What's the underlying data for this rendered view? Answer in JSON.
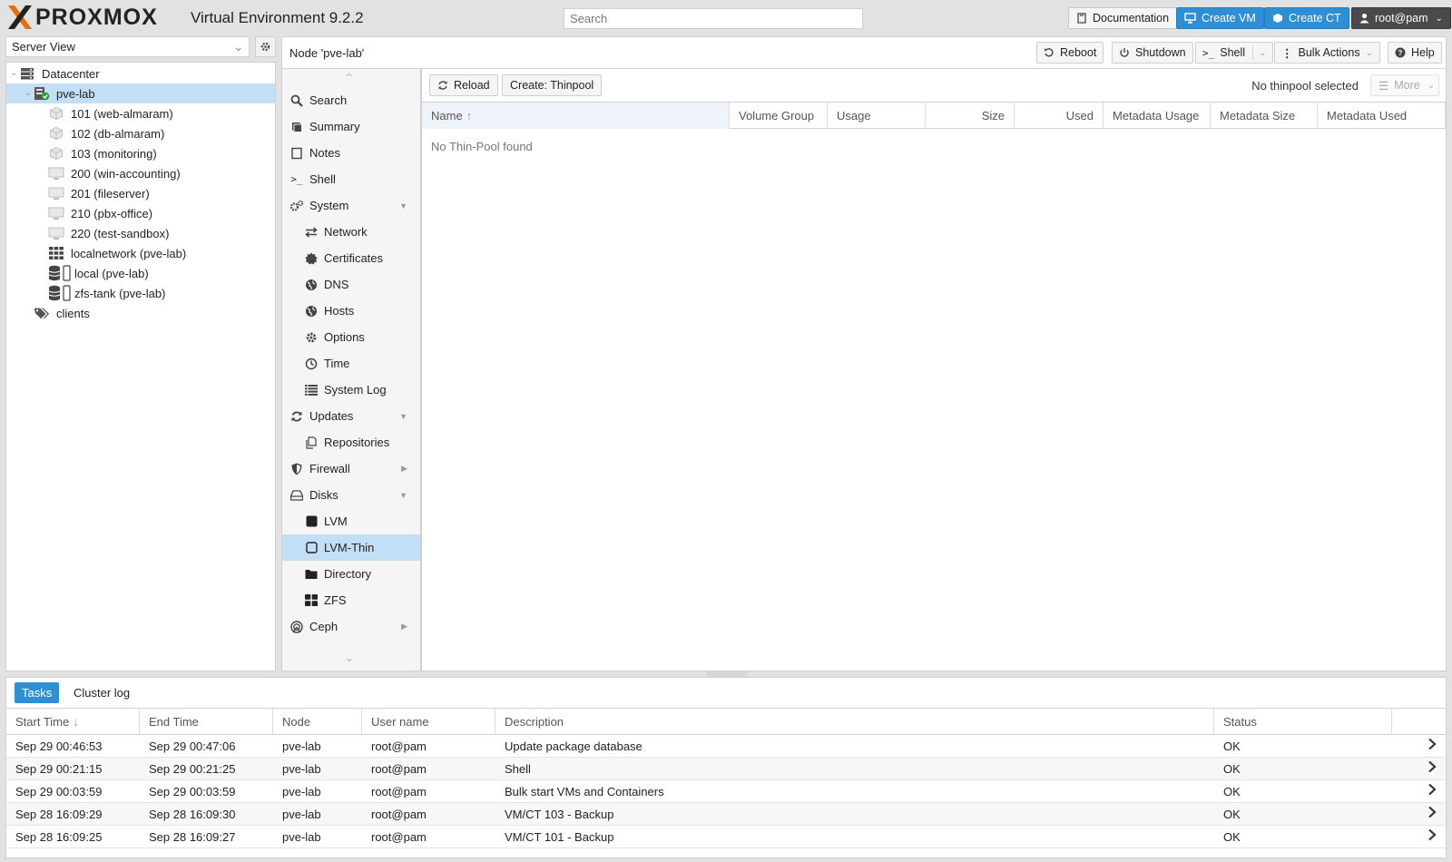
{
  "header": {
    "brand": "PROXMOX",
    "product_title": "Virtual Environment 9.2.2",
    "search_placeholder": "Search",
    "buttons": {
      "documentation": "Documentation",
      "create_vm": "Create VM",
      "create_ct": "Create CT",
      "user": "root@pam"
    }
  },
  "left": {
    "view_select": "Server View",
    "tree": [
      {
        "label": "Datacenter",
        "icon": "datacenter-icon",
        "indent": 0
      },
      {
        "label": "pve-lab",
        "icon": "node-online-icon",
        "indent": 1,
        "selected": true
      },
      {
        "label": "101 (web-almaram)",
        "icon": "container-icon",
        "indent": 2
      },
      {
        "label": "102 (db-almaram)",
        "icon": "container-icon",
        "indent": 2
      },
      {
        "label": "103 (monitoring)",
        "icon": "container-icon",
        "indent": 2
      },
      {
        "label": "200 (win-accounting)",
        "icon": "vm-icon",
        "indent": 2
      },
      {
        "label": "201 (fileserver)",
        "icon": "vm-icon",
        "indent": 2
      },
      {
        "label": "210 (pbx-office)",
        "icon": "vm-icon",
        "indent": 2
      },
      {
        "label": "220 (test-sandbox)",
        "icon": "vm-icon",
        "indent": 2
      },
      {
        "label": "localnetwork (pve-lab)",
        "icon": "sdn-grid-icon",
        "indent": 2
      },
      {
        "label": "local (pve-lab)",
        "icon": "storage-icon",
        "indent": 2
      },
      {
        "label": "zfs-tank (pve-lab)",
        "icon": "storage-icon",
        "indent": 2
      },
      {
        "label": "clients",
        "icon": "tags-icon",
        "indent": 1
      }
    ]
  },
  "node": {
    "title": "Node 'pve-lab'",
    "toolbar": {
      "reboot": "Reboot",
      "shutdown": "Shutdown",
      "shell": "Shell",
      "bulk_actions": "Bulk Actions",
      "help": "Help"
    }
  },
  "nav": [
    {
      "label": "Search",
      "icon": "search-icon",
      "sub": false
    },
    {
      "label": "Summary",
      "icon": "book-icon",
      "sub": false
    },
    {
      "label": "Notes",
      "icon": "note-icon",
      "sub": false
    },
    {
      "label": "Shell",
      "icon": "terminal-icon",
      "sub": false
    },
    {
      "label": "System",
      "icon": "cogs-icon",
      "sub": false,
      "arrow": "down"
    },
    {
      "label": "Network",
      "icon": "network-icon",
      "sub": true
    },
    {
      "label": "Certificates",
      "icon": "certificate-icon",
      "sub": true
    },
    {
      "label": "DNS",
      "icon": "globe-icon",
      "sub": true
    },
    {
      "label": "Hosts",
      "icon": "globe-icon",
      "sub": true
    },
    {
      "label": "Options",
      "icon": "gear-icon",
      "sub": true
    },
    {
      "label": "Time",
      "icon": "clock-icon",
      "sub": true
    },
    {
      "label": "System Log",
      "icon": "list-icon",
      "sub": true
    },
    {
      "label": "Updates",
      "icon": "refresh-icon",
      "sub": false,
      "arrow": "down"
    },
    {
      "label": "Repositories",
      "icon": "files-icon",
      "sub": true
    },
    {
      "label": "Firewall",
      "icon": "shield-icon",
      "sub": false,
      "arrow": "right"
    },
    {
      "label": "Disks",
      "icon": "hdd-icon",
      "sub": false,
      "arrow": "down"
    },
    {
      "label": "LVM",
      "icon": "square-filled-icon",
      "sub": true
    },
    {
      "label": "LVM-Thin",
      "icon": "square-outline-icon",
      "sub": true,
      "selected": true
    },
    {
      "label": "Directory",
      "icon": "folder-icon",
      "sub": true
    },
    {
      "label": "ZFS",
      "icon": "th-large-icon",
      "sub": true
    },
    {
      "label": "Ceph",
      "icon": "ceph-icon",
      "sub": false,
      "arrow": "right"
    }
  ],
  "content": {
    "reload": "Reload",
    "create_thinpool": "Create: Thinpool",
    "no_selection": "No thinpool selected",
    "more": "More",
    "columns": [
      "Name",
      "Volume Group",
      "Usage",
      "Size",
      "Used",
      "Metadata Usage",
      "Metadata Size",
      "Metadata Used"
    ],
    "empty_text": "No Thin-Pool found"
  },
  "log": {
    "tabs": [
      "Tasks",
      "Cluster log"
    ],
    "columns": [
      "Start Time",
      "End Time",
      "Node",
      "User name",
      "Description",
      "Status"
    ],
    "rows": [
      [
        "Sep 29 00:46:53",
        "Sep 29 00:47:06",
        "pve-lab",
        "root@pam",
        "Update package database",
        "OK"
      ],
      [
        "Sep 29 00:21:15",
        "Sep 29 00:21:25",
        "pve-lab",
        "root@pam",
        "Shell",
        "OK"
      ],
      [
        "Sep 29 00:03:59",
        "Sep 29 00:03:59",
        "pve-lab",
        "root@pam",
        "Bulk start VMs and Containers",
        "OK"
      ],
      [
        "Sep 28 16:09:29",
        "Sep 28 16:09:30",
        "pve-lab",
        "root@pam",
        "VM/CT 103 - Backup",
        "OK"
      ],
      [
        "Sep 28 16:09:25",
        "Sep 28 16:09:27",
        "pve-lab",
        "root@pam",
        "VM/CT 101 - Backup",
        "OK"
      ]
    ]
  },
  "colors": {
    "accent": "#2f8fd6",
    "selected": "#c3dff5",
    "logo_orange": "#e57000"
  }
}
